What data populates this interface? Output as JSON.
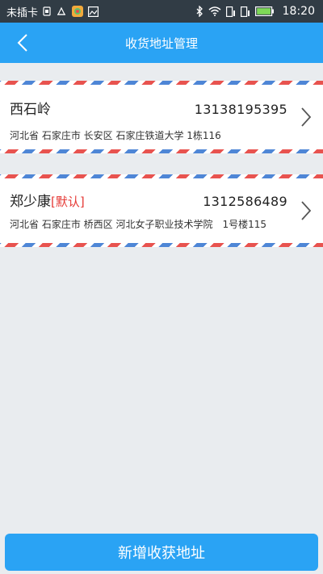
{
  "status_bar": {
    "carrier": "未插卡",
    "time": "18:20"
  },
  "header": {
    "title": "收货地址管理"
  },
  "addresses": [
    {
      "name": "西石岭",
      "default_tag": "",
      "phone": "13138195395",
      "address": "河北省 石家庄市 长安区 石家庄铁道大学 1栋116"
    },
    {
      "name": "郑少康",
      "default_tag": "[默认]",
      "phone": "1312586489",
      "address": "河北省 石家庄市 桥西区 河北女子职业技术学院　1号楼115"
    }
  ],
  "footer": {
    "add_label": "新增收获地址"
  },
  "colors": {
    "accent": "#2aa3f4",
    "default_tag": "#e53935",
    "status_bar": "#313c45"
  }
}
